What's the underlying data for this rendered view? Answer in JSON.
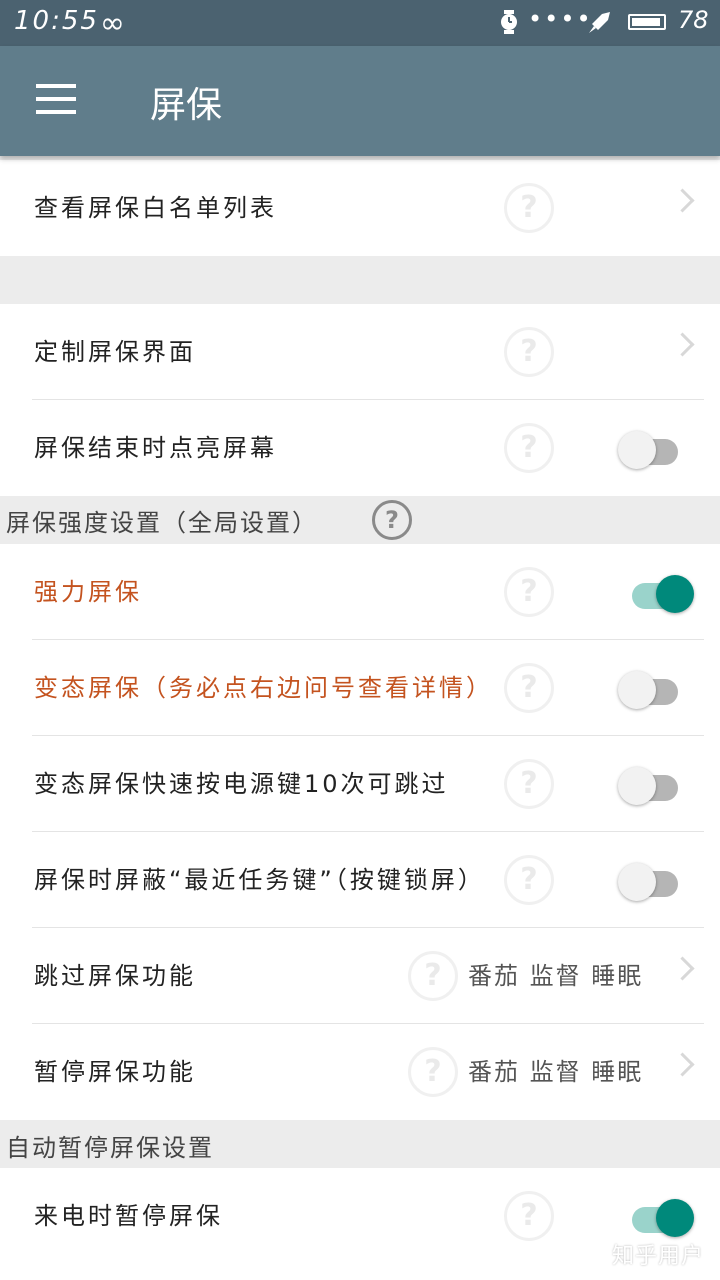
{
  "status_bar": {
    "time": "10:55",
    "infinity": "∞",
    "dots": "••••",
    "battery_level": "78"
  },
  "appbar": {
    "title": "屏保"
  },
  "rows": {
    "whitelist": {
      "label": "查看屏保白名单列表"
    },
    "customize": {
      "label": "定制屏保界面"
    },
    "wake_on_end": {
      "label": "屏保结束时点亮屏幕",
      "enabled": false
    },
    "strong": {
      "label": "强力屏保",
      "enabled": true
    },
    "hardcore": {
      "label": "变态屏保（务必点右边问号查看详情）",
      "enabled": false
    },
    "power_skip": {
      "label": "变态屏保快速按电源键10次可跳过",
      "enabled": false
    },
    "block_recent": {
      "label": "屏保时屏蔽“最近任务键”（按键锁屏）",
      "enabled": false
    },
    "skip_feature": {
      "label": "跳过屏保功能",
      "value": "番茄 监督 睡眠"
    },
    "pause_feature": {
      "label": "暂停屏保功能",
      "value": "番茄 监督 睡眠"
    },
    "pause_on_call": {
      "label": "来电时暂停屏保",
      "enabled": true
    }
  },
  "sections": {
    "strength": "屏保强度设置（全局设置）",
    "auto_pause": "自动暂停屏保设置"
  },
  "help_glyph": "?",
  "watermark": "知乎用户",
  "colors": {
    "appbar": "#607d8b",
    "statusbar": "#4b6270",
    "toggle_on": "#00897b",
    "warning_text": "#c4531f"
  }
}
